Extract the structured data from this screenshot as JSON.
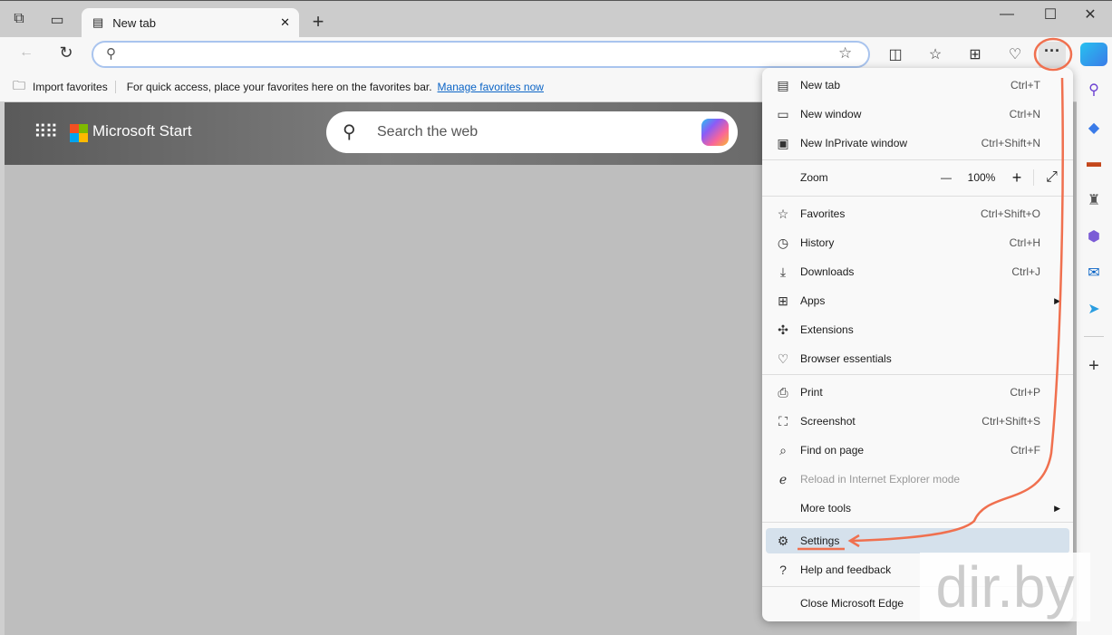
{
  "tab": {
    "title": "New tab"
  },
  "window": {
    "minimize": "—",
    "maximize": "☐",
    "close": "✕"
  },
  "favorites_bar": {
    "import": "Import favorites",
    "hint": "For quick access, place your favorites here on the favorites bar.",
    "manage_link": "Manage favorites now"
  },
  "page": {
    "brand": "Microsoft Start",
    "search_placeholder": "Search the web"
  },
  "menu": {
    "items": [
      {
        "label": "New tab",
        "shortcut": "Ctrl+T",
        "icon": "new-tab-icon"
      },
      {
        "label": "New window",
        "shortcut": "Ctrl+N",
        "icon": "window-icon"
      },
      {
        "label": "New InPrivate window",
        "shortcut": "Ctrl+Shift+N",
        "icon": "inprivate-icon"
      },
      {
        "label": "Favorites",
        "shortcut": "Ctrl+Shift+O",
        "icon": "star-icon"
      },
      {
        "label": "History",
        "shortcut": "Ctrl+H",
        "icon": "history-icon"
      },
      {
        "label": "Downloads",
        "shortcut": "Ctrl+J",
        "icon": "download-icon"
      },
      {
        "label": "Apps",
        "shortcut": "",
        "icon": "apps-icon"
      },
      {
        "label": "Extensions",
        "shortcut": "",
        "icon": "puzzle-icon"
      },
      {
        "label": "Browser essentials",
        "shortcut": "",
        "icon": "heart-pulse-icon"
      },
      {
        "label": "Print",
        "shortcut": "Ctrl+P",
        "icon": "print-icon"
      },
      {
        "label": "Screenshot",
        "shortcut": "Ctrl+Shift+S",
        "icon": "screenshot-icon"
      },
      {
        "label": "Find on page",
        "shortcut": "Ctrl+F",
        "icon": "find-icon"
      },
      {
        "label": "Reload in Internet Explorer mode",
        "shortcut": "",
        "icon": "ie-icon",
        "disabled": true
      },
      {
        "label": "More tools",
        "shortcut": "",
        "icon": ""
      },
      {
        "label": "Settings",
        "shortcut": "",
        "icon": "gear-icon",
        "selected": true
      },
      {
        "label": "Help and feedback",
        "shortcut": "",
        "icon": "help-icon"
      },
      {
        "label": "Close Microsoft Edge",
        "shortcut": "",
        "icon": ""
      }
    ],
    "zoom": {
      "label": "Zoom",
      "value": "100%",
      "minus": "—",
      "plus": "+"
    }
  },
  "annotation_color": "#f0704f",
  "watermark": "dir.by"
}
